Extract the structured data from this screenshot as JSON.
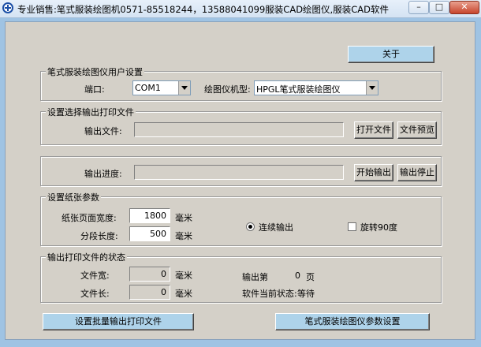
{
  "window": {
    "title": "专业销售:笔式服装绘图机0571-85518244，13588041099服装CAD绘图仪,服装CAD软件",
    "minimize_label": "–",
    "maximize_label": "□",
    "close_label": "✕"
  },
  "about_button": "关于",
  "plotter_group": {
    "title": "笔式服装绘图仪用户设置",
    "port_label": "端口:",
    "port_value": "COM1",
    "model_label": "绘图仪机型:",
    "model_value": "HPGL笔式服装绘图仪"
  },
  "file_group": {
    "title": "设置选择输出打印文件",
    "output_file_label": "输出文件:",
    "output_file_value": "",
    "open_button": "打开文件",
    "preview_button": "文件预览"
  },
  "progress_group": {
    "progress_label": "输出进度:",
    "progress_fraction": 0,
    "start_button": "开始输出",
    "stop_button": "输出停止"
  },
  "paper_group": {
    "title": "设置纸张参数",
    "width_label": "纸张页面宽度:",
    "width_value": "1800",
    "width_unit": "毫米",
    "segment_label": "分段长度:",
    "segment_value": "500",
    "segment_unit": "毫米",
    "continuous_label": "连续输出",
    "rotate_label": "旋转90度"
  },
  "status_group": {
    "title": "输出打印文件的状态",
    "file_width_label": "文件宽:",
    "file_width_value": "0",
    "file_width_unit": "毫米",
    "file_length_label": "文件长:",
    "file_length_value": "0",
    "file_length_unit": "毫米",
    "output_page_prefix": "输出第",
    "output_page_value": "0",
    "output_page_suffix": "页",
    "current_status_label": "软件当前状态:",
    "current_status_value": "等待"
  },
  "batch_button": "设置批量输出打印文件",
  "params_button": "笔式服装绘图仪参数设置"
}
